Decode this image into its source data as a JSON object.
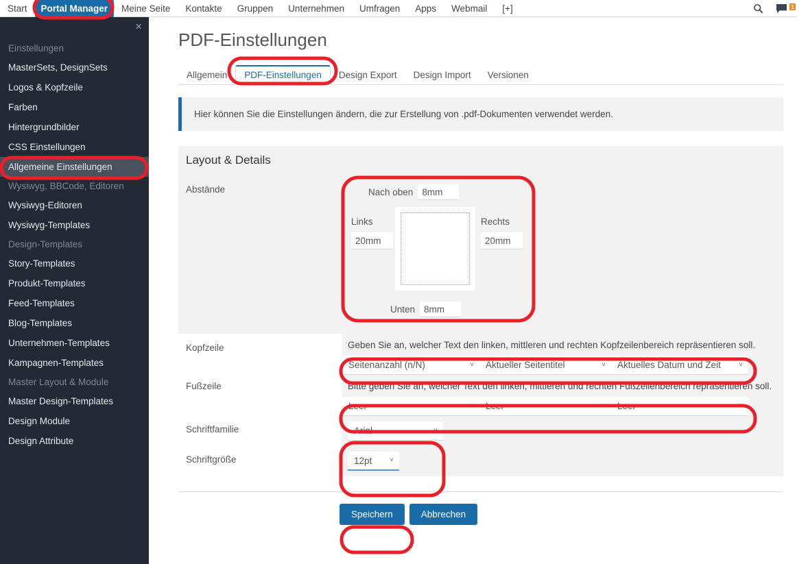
{
  "topnav": {
    "items": [
      {
        "label": "Start",
        "active": false
      },
      {
        "label": "Portal Manager",
        "active": true
      },
      {
        "label": "Meine Seite",
        "active": false
      },
      {
        "label": "Kontakte",
        "active": false
      },
      {
        "label": "Gruppen",
        "active": false
      },
      {
        "label": "Unternehmen",
        "active": false
      },
      {
        "label": "Umfragen",
        "active": false
      },
      {
        "label": "Apps",
        "active": false
      },
      {
        "label": "Webmail",
        "active": false
      },
      {
        "label": "[+]",
        "active": false
      }
    ],
    "search_icon": "search-icon",
    "messages_icon": "message-bubble-icon",
    "messages_badge": "1"
  },
  "sidebar": {
    "close_label": "×",
    "groups": [
      {
        "title": "Einstellungen",
        "items": [
          {
            "label": "MasterSets, DesignSets",
            "active": false
          },
          {
            "label": "Logos & Kopfzeile",
            "active": false
          },
          {
            "label": "Farben",
            "active": false
          },
          {
            "label": "Hintergrundbilder",
            "active": false
          },
          {
            "label": "CSS Einstellungen",
            "active": false
          },
          {
            "label": "Allgemeine Einstellungen",
            "active": true
          }
        ]
      },
      {
        "title": "Wysiwyg, BBCode, Editoren",
        "items": [
          {
            "label": "Wysiwyg-Editoren",
            "active": false
          },
          {
            "label": "Wysiwyg-Templates",
            "active": false
          }
        ]
      },
      {
        "title": "Design-Templates",
        "items": [
          {
            "label": "Story-Templates",
            "active": false
          },
          {
            "label": "Produkt-Templates",
            "active": false
          },
          {
            "label": "Feed-Templates",
            "active": false
          },
          {
            "label": "Blog-Templates",
            "active": false
          },
          {
            "label": "Unternehmen-Templates",
            "active": false
          },
          {
            "label": "Kampagnen-Templates",
            "active": false
          }
        ]
      },
      {
        "title": "Master Layout & Module",
        "items": [
          {
            "label": "Master Design-Templates",
            "active": false
          },
          {
            "label": "Design Module",
            "active": false
          },
          {
            "label": "Design Attribute",
            "active": false
          }
        ]
      }
    ]
  },
  "main": {
    "page_title": "PDF-Einstellungen",
    "tabs": [
      {
        "label": "Allgemein",
        "active": false
      },
      {
        "label": "PDF-Einstellungen",
        "active": true
      },
      {
        "label": "Design Export",
        "active": false
      },
      {
        "label": "Design Import",
        "active": false
      },
      {
        "label": "Versionen",
        "active": false
      }
    ],
    "info_banner": "Hier können Sie die Einstellungen ändern, die zur Erstellung von .pdf-Dokumenten verwendet werden.",
    "section_header": "Layout & Details",
    "margins": {
      "label": "Abstände",
      "top_label": "Nach oben",
      "top_value": "8mm",
      "bottom_label": "Unten",
      "bottom_value": "8mm",
      "left_label": "Links",
      "left_value": "20mm",
      "right_label": "Rechts",
      "right_value": "20mm"
    },
    "header_row": {
      "label": "Kopfzeile",
      "hint": "Geben Sie an, welcher Text den linken, mittleren und rechten Kopfzeilenbereich repräsentieren soll.",
      "selects": [
        {
          "value": "Seitenanzahl (n/N)"
        },
        {
          "value": "Aktueller Seitentitel"
        },
        {
          "value": "Aktuelles Datum und Zeit"
        }
      ]
    },
    "footer_row": {
      "label": "Fußzeile",
      "hint": "Bitte geben Sie an, welcher Text den linken, mittleren und rechten Fußzeilenbereich repräsentieren soll.",
      "selects": [
        {
          "value": "Leer"
        },
        {
          "value": "Leer"
        },
        {
          "value": "Leer"
        }
      ]
    },
    "font_family": {
      "label": "Schriftfamilie",
      "value": "Arial"
    },
    "font_size": {
      "label": "Schriftgröße",
      "value": "12pt"
    },
    "buttons": {
      "save": "Speichern",
      "cancel": "Abbrechen"
    }
  },
  "colors": {
    "accent_blue": "#1a6ca8",
    "sidebar_bg": "#232a35",
    "sidebar_active": "#4a515d",
    "panel_gray": "#f2f2f2",
    "annotation_red": "#e8202a",
    "badge_orange": "#f08c1b"
  }
}
